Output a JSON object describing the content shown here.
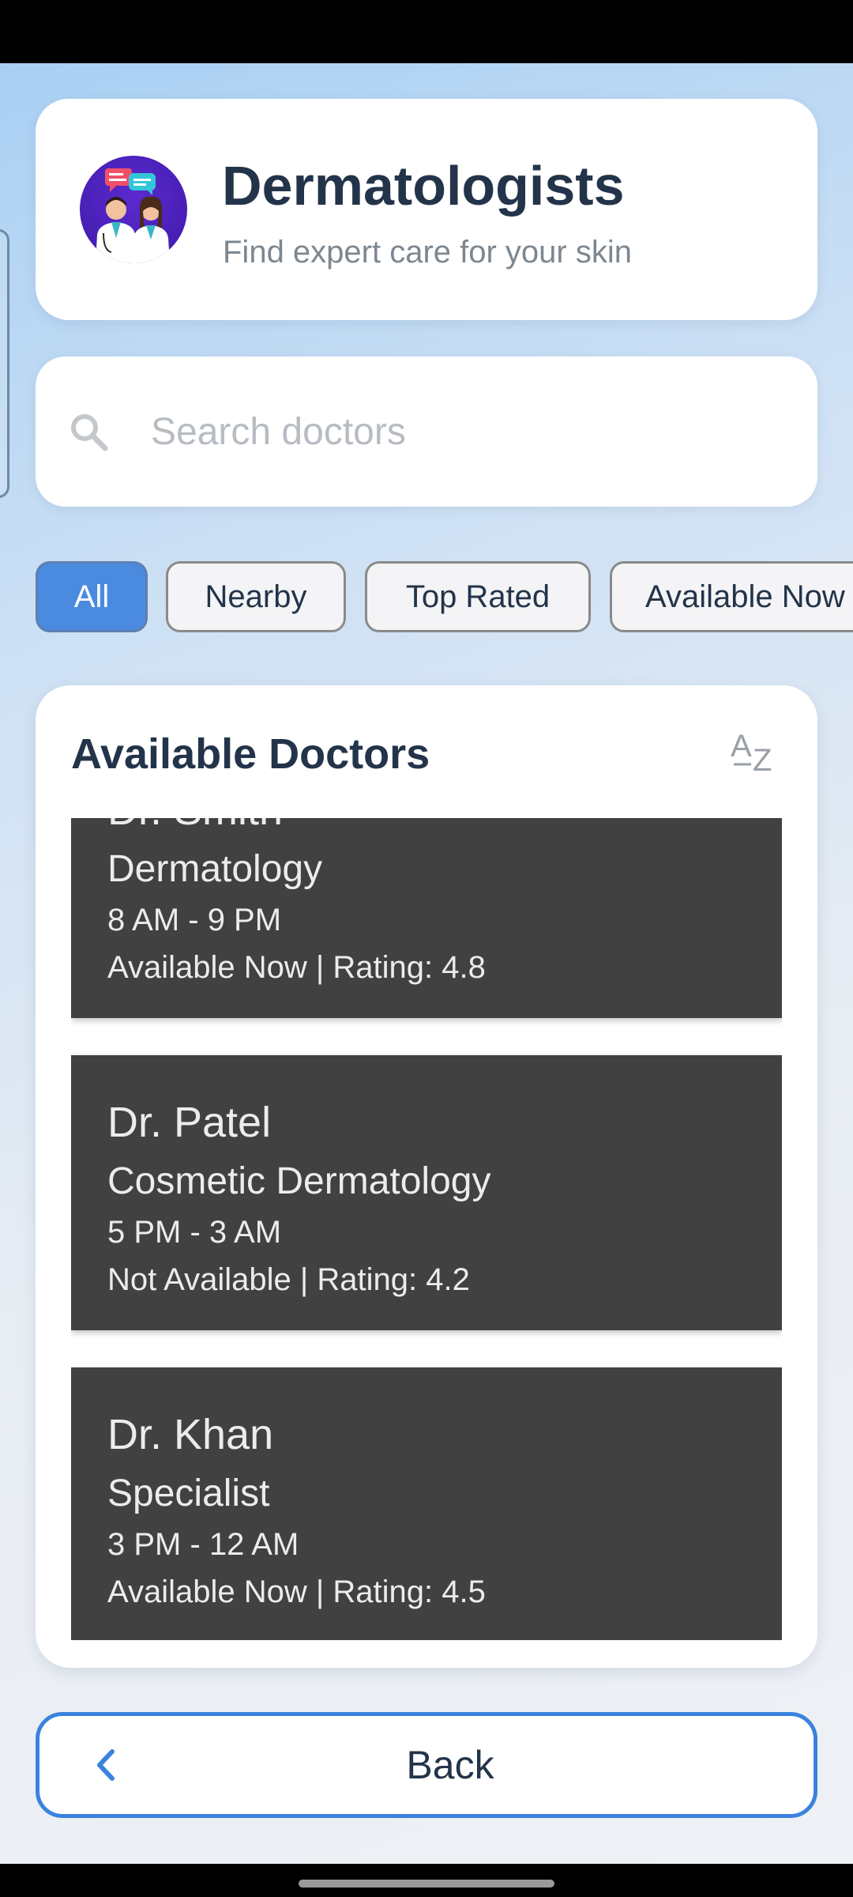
{
  "header": {
    "title": "Dermatologists",
    "subtitle": "Find expert care for your skin",
    "avatar_icon": "doctors-chat-illustration"
  },
  "search": {
    "placeholder": "Search doctors",
    "value": "",
    "icon": "search-icon"
  },
  "filters": [
    {
      "label": "All",
      "active": true
    },
    {
      "label": "Nearby",
      "active": false
    },
    {
      "label": "Top Rated",
      "active": false
    },
    {
      "label": "Available Now",
      "active": false
    }
  ],
  "doctors_section": {
    "title": "Available Doctors",
    "sort_icon": "sort-az-icon",
    "doctors": [
      {
        "name": "Dr. Smith",
        "specialty": "Dermatology",
        "hours": "8 AM - 9 PM",
        "status": "Available Now | Rating: 4.8"
      },
      {
        "name": "Dr. Patel",
        "specialty": "Cosmetic Dermatology",
        "hours": "5 PM - 3 AM",
        "status": "Not Available | Rating: 4.2"
      },
      {
        "name": "Dr. Khan",
        "specialty": "Specialist",
        "hours": "3 PM - 12 AM",
        "status": "Available Now | Rating: 4.5"
      }
    ]
  },
  "back_button": {
    "label": "Back",
    "icon": "chevron-left-icon"
  },
  "colors": {
    "accent": "#3a82dd",
    "chip_active": "#4a8be0",
    "title_text": "#23344a",
    "doctor_card_bg": "#414141"
  }
}
